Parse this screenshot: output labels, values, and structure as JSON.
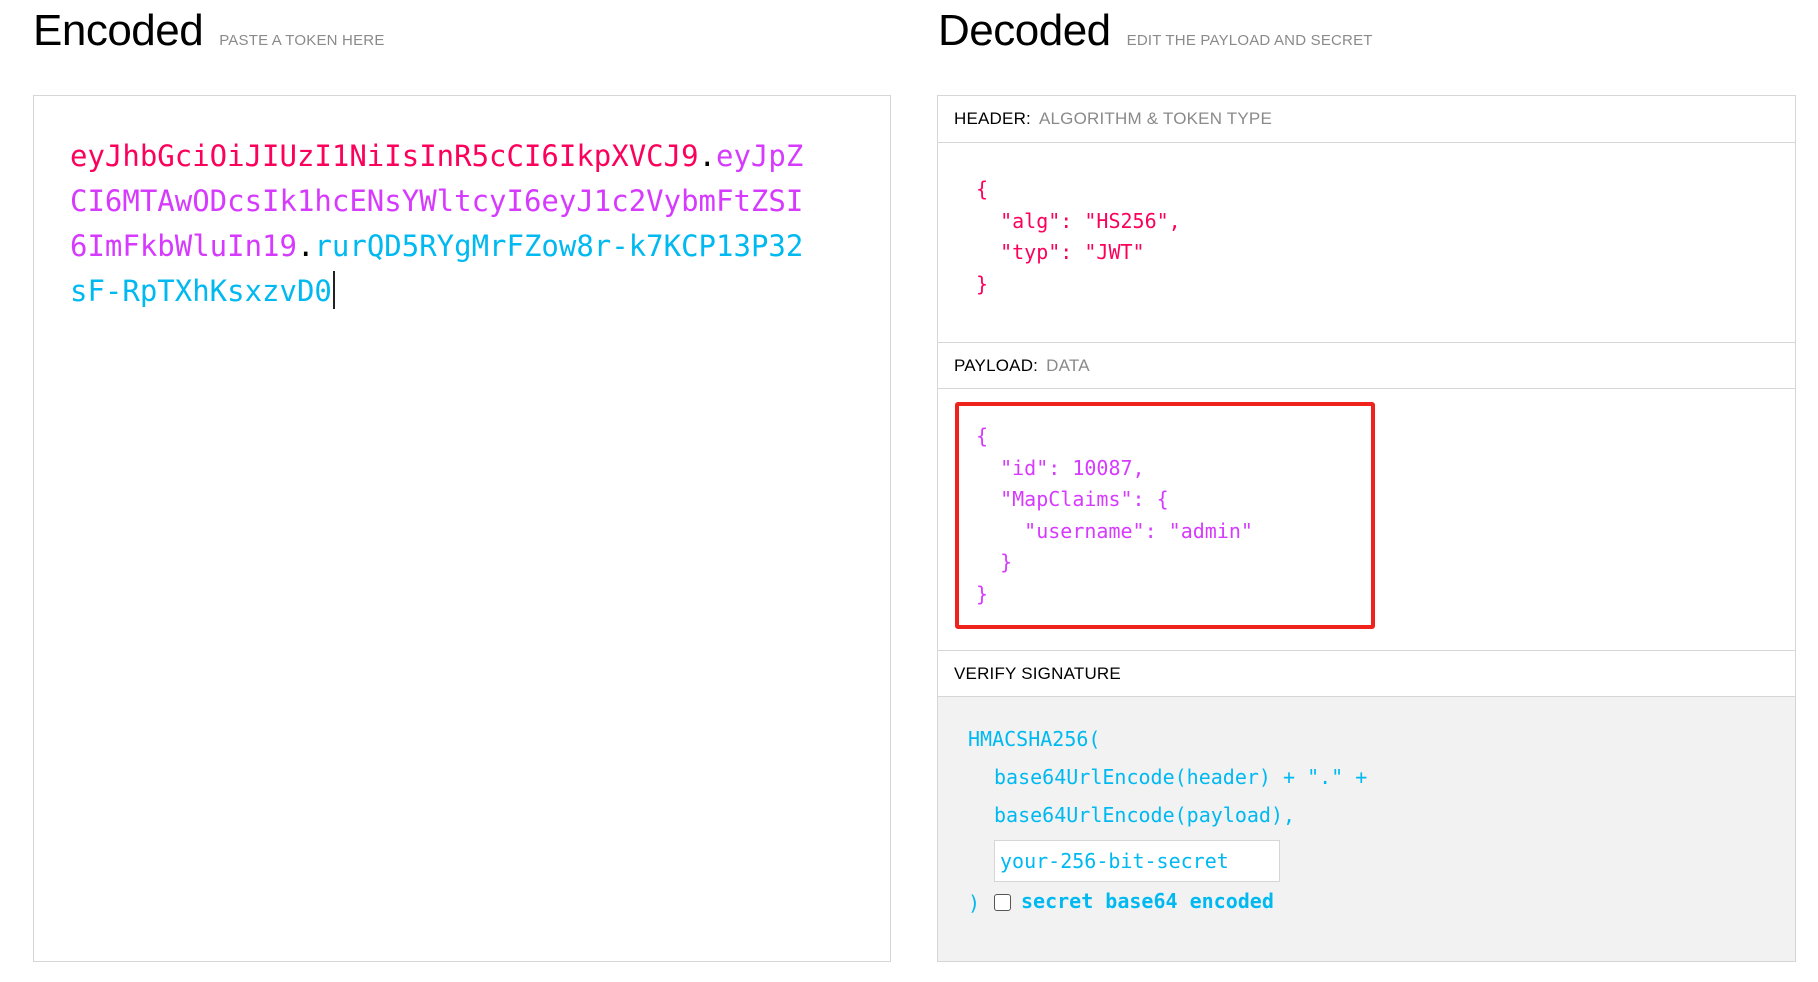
{
  "encoded": {
    "title": "Encoded",
    "subtitle": "PASTE A TOKEN HERE",
    "token": {
      "header_part": "eyJhbGciOiJIUzI1NiIsInR5cCI6IkpXVCJ9",
      "payload_part": "eyJpZCI6MTAwODcsIk1hcENsYWltcyI6eyJ1c2VybmFtZSI6ImFkbWluIn19",
      "signature_part": "rurQD5RYgMrFZow8r-k7KCP13P32sF-RpTXhKsxzvD0",
      "separator": "."
    }
  },
  "decoded": {
    "title": "Decoded",
    "subtitle": "EDIT THE PAYLOAD AND SECRET",
    "header_section": {
      "label": "HEADER:",
      "hint": "ALGORITHM & TOKEN TYPE",
      "json": "{\n  \"alg\": \"HS256\",\n  \"typ\": \"JWT\"\n}"
    },
    "payload_section": {
      "label": "PAYLOAD:",
      "hint": "DATA",
      "json": "{\n  \"id\": 10087,\n  \"MapClaims\": {\n    \"username\": \"admin\"\n  }\n}",
      "highlight_color": "#f0221c"
    },
    "verify_section": {
      "label": "VERIFY SIGNATURE",
      "line1": "HMACSHA256(",
      "line2": "base64UrlEncode(header) + \".\" +",
      "line3": "base64UrlEncode(payload),",
      "secret_placeholder": "your-256-bit-secret",
      "close": ")",
      "checkbox_label": "secret base64 encoded"
    }
  },
  "colors": {
    "header": "#fb015b",
    "payload": "#d63aff",
    "signature": "#00b9f1"
  }
}
